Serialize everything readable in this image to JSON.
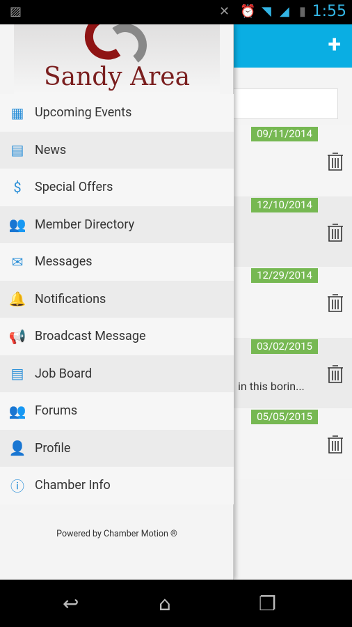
{
  "status": {
    "time": "1:55"
  },
  "appbar": {
    "add_icon": "plus-icon"
  },
  "events": [
    {
      "date": "09/11/2014",
      "snippet": ""
    },
    {
      "date": "12/10/2014",
      "snippet": ""
    },
    {
      "date": "12/29/2014",
      "snippet": ""
    },
    {
      "date": "03/02/2015",
      "snippet": "in this borin..."
    },
    {
      "date": "05/05/2015",
      "snippet": ""
    }
  ],
  "drawer": {
    "logo_text": "Sandy Area",
    "items": [
      {
        "label": "Upcoming Events",
        "icon": "calendar-icon"
      },
      {
        "label": "News",
        "icon": "document-icon"
      },
      {
        "label": "Special Offers",
        "icon": "dollar-icon"
      },
      {
        "label": "Member Directory",
        "icon": "users-icon"
      },
      {
        "label": "Messages",
        "icon": "envelope-icon"
      },
      {
        "label": "Notifications",
        "icon": "bell-icon"
      },
      {
        "label": "Broadcast Message",
        "icon": "megaphone-icon"
      },
      {
        "label": "Job Board",
        "icon": "document-icon"
      },
      {
        "label": "Forums",
        "icon": "group-icon"
      },
      {
        "label": "Profile",
        "icon": "person-icon"
      },
      {
        "label": "Chamber Info",
        "icon": "info-icon"
      }
    ],
    "powered": "Powered by Chamber Motion ®"
  },
  "colors": {
    "accent": "#0aaee3",
    "date_badge": "#76b852",
    "icon": "#2a8fd8"
  }
}
